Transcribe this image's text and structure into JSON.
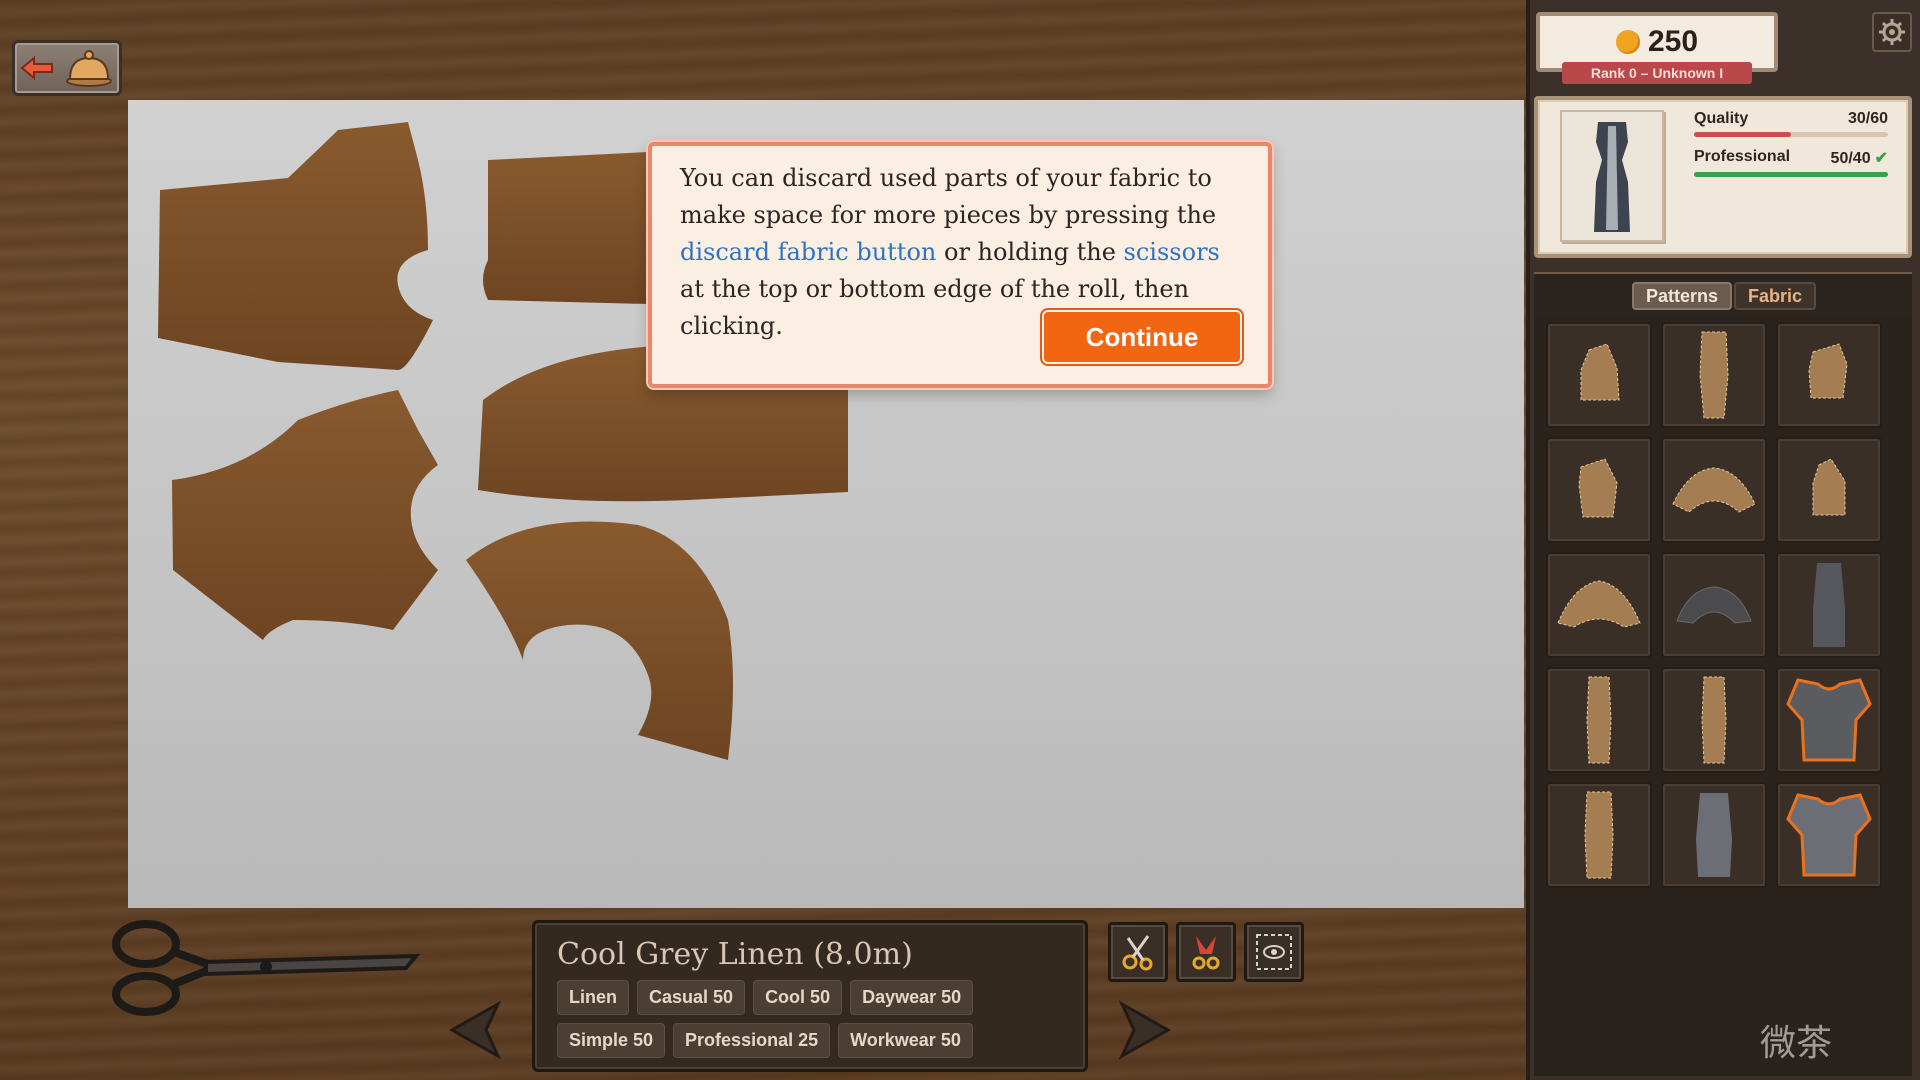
{
  "tutorial": {
    "part1": "You can discard used parts of your fabric to make space for more pieces by pressing the ",
    "link1": "discard fabric button",
    "part2": " or holding the ",
    "link2": "scissors",
    "part3": " at the top or bottom edge of the roll, then clicking.",
    "continue_label": "Continue"
  },
  "fabric": {
    "name": "Cool Grey Linen (8.0m)",
    "tags": [
      "Linen",
      "Casual 50",
      "Cool 50",
      "Daywear 50",
      "Simple 50",
      "Professional 25",
      "Workwear 50"
    ]
  },
  "currency": {
    "coins": "250",
    "rank": "Rank 0 – Unknown I"
  },
  "order": {
    "quality_label": "Quality",
    "quality_value": "30/60",
    "quality_fraction": 0.5,
    "professional_label": "Professional",
    "professional_value": "50/40",
    "professional_fraction": 1.0
  },
  "tabs": {
    "patterns": "Patterns",
    "fabric": "Fabric"
  },
  "colors": {
    "accent": "#f26511",
    "link": "#2d73c2",
    "quality_bar": "#c9504f",
    "professional_bar": "#3aa04a",
    "fabric_grey": "#c8c8c8"
  },
  "icons": [
    "back-arrow-icon",
    "service-bell-icon",
    "gear-icon",
    "coin-icon",
    "scissors-icon",
    "discard-fabric-icon",
    "view-toggle-icon",
    "prev-arrow-icon",
    "next-arrow-icon"
  ],
  "watermark": "微茶"
}
